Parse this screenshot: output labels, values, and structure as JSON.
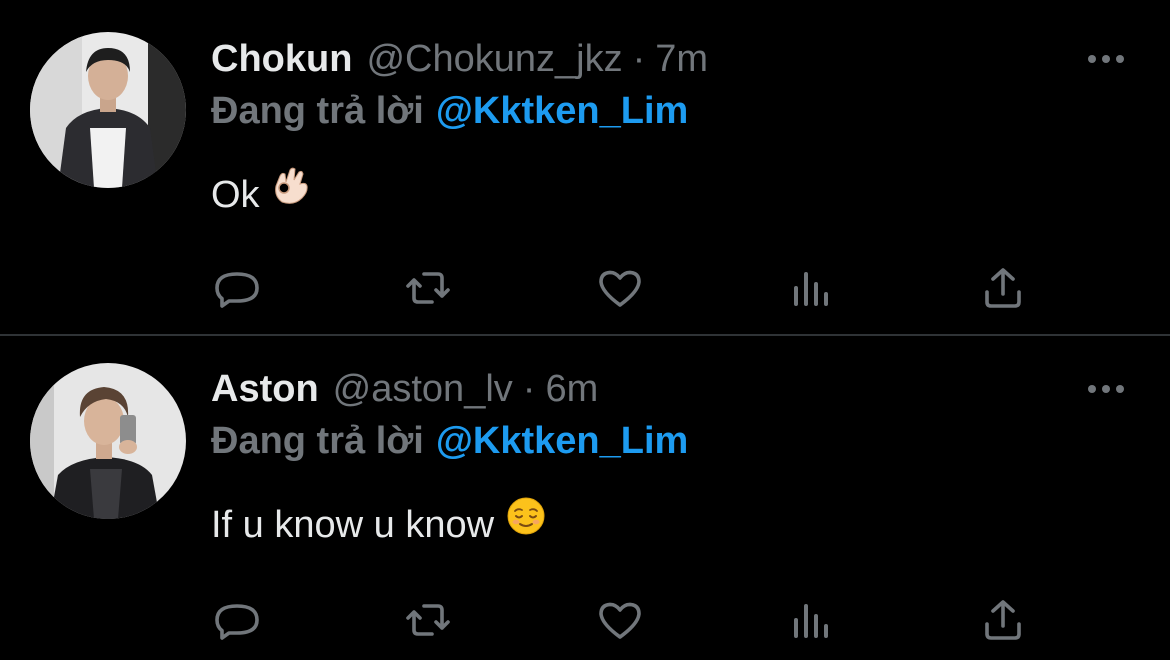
{
  "tweets": [
    {
      "name": "Chokun",
      "handle": "@Chokunz_jkz",
      "separator": "·",
      "time": "7m",
      "reply_prefix": "Đang trả lời",
      "reply_to": "@Kktken_Lim",
      "text": "Ok",
      "emoji": "ok-hand-emoji"
    },
    {
      "name": "Aston",
      "handle": "@aston_lv",
      "separator": "·",
      "time": "6m",
      "reply_prefix": "Đang trả lời",
      "reply_to": "@Kktken_Lim",
      "text": "If u know u know",
      "emoji": "relieved-face-emoji"
    }
  ],
  "actions": [
    "reply-icon",
    "retweet-icon",
    "like-icon",
    "views-icon",
    "share-icon"
  ],
  "colors": {
    "background": "#000000",
    "primary_text": "#e7e9ea",
    "secondary_text": "#71767b",
    "link": "#1d9bf0",
    "divider": "#2f3336"
  }
}
